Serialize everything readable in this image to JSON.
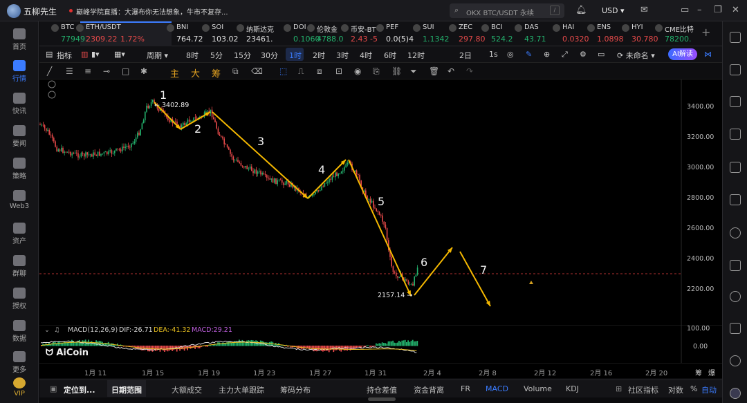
{
  "app": {
    "name": "五柳先生"
  },
  "titlebar": {
    "news": "巅峰学院直播：大瀑布你无法想象，牛市不复存...",
    "search_placeholder": "OKX BTC/USDT 永续",
    "search_shortcut": "/",
    "currency": "USD"
  },
  "sidebar": {
    "items": [
      {
        "label": "首页"
      },
      {
        "label": "行情"
      },
      {
        "label": "快讯"
      },
      {
        "label": "要闻"
      },
      {
        "label": "策略"
      },
      {
        "label": "Web3"
      },
      {
        "label": "资产"
      },
      {
        "label": "群聊"
      },
      {
        "label": "授权"
      },
      {
        "label": "数据"
      },
      {
        "label": "更多"
      },
      {
        "label": "VIP"
      }
    ]
  },
  "tickers": [
    {
      "name": "BTC",
      "price": "77949.",
      "dir": "up"
    },
    {
      "name": "ETH/USDT",
      "price": "2309.22",
      "change": "1.72%",
      "dir": "dn"
    },
    {
      "name": "BNI",
      "price": "764.72",
      "dir": "wh"
    },
    {
      "name": "SOI",
      "price": "103.02",
      "dir": "wh"
    },
    {
      "name": "纳斯达克",
      "price": "23461.",
      "dir": "wh"
    },
    {
      "name": "DOI",
      "price": "0.1060",
      "dir": "up"
    },
    {
      "name": "伦敦金",
      "price": "4788.0",
      "dir": "up"
    },
    {
      "name": "币安-BT",
      "price": "2.43 -5",
      "dir": "dn"
    },
    {
      "name": "PEF",
      "price": "0.0(5)4",
      "dir": "wh"
    },
    {
      "name": "SUI",
      "price": "1.1342",
      "dir": "up"
    },
    {
      "name": "ZEC",
      "price": "297.80",
      "dir": "dn"
    },
    {
      "name": "BCI",
      "price": "524.2",
      "dir": "up"
    },
    {
      "name": "DAS",
      "price": "43.71",
      "dir": "up"
    },
    {
      "name": "HAI",
      "price": "0.0320",
      "dir": "dn"
    },
    {
      "name": "ENS",
      "price": "1.0898",
      "dir": "dn"
    },
    {
      "name": "HYI",
      "price": "30.780",
      "dir": "dn"
    },
    {
      "name": "CME比特",
      "price": "78200.",
      "dir": "up"
    }
  ],
  "toolbar": {
    "indicator": "指标",
    "period": "周期",
    "timeframes": [
      "8时",
      "5分",
      "15分",
      "30分",
      "1时",
      "2时",
      "3时",
      "4时",
      "6时",
      "12时",
      "2日",
      "1s"
    ],
    "active_timeframe": "1时",
    "layout_name": "未命名",
    "ai_label": "AI解读"
  },
  "drawtools": {
    "main": "主",
    "big": "大",
    "chips": "筹"
  },
  "chart": {
    "price_labels": [
      "3400.00",
      "3200.00",
      "3000.00",
      "2800.00",
      "2600.00",
      "2400.00",
      "2200.00"
    ],
    "high_label": "3402.89",
    "low_label": "2157.14",
    "wave_labels": [
      "1",
      "2",
      "3",
      "4",
      "5",
      "6",
      "7"
    ],
    "macd": {
      "params": "MACD(12,26,9)",
      "dif": "DIF:-26.71",
      "dea": "DEA:-41.32",
      "macd": "MACD:29.21"
    },
    "macd_axis": [
      "100.00",
      "0.00"
    ],
    "date_labels": [
      "1月 11",
      "1月 15",
      "1月 19",
      "1月 23",
      "1月 27",
      "1月 31",
      "2月 4",
      "2月 8",
      "2月 12",
      "2月 16",
      "2月 20"
    ],
    "watermark": "AiCoin",
    "corner_labels": [
      "筹",
      "爆"
    ]
  },
  "bottombar": {
    "items": [
      "定位到...",
      "日期范围",
      "大额成交",
      "主力大单跟踪",
      "筹码分布",
      "持仓差值",
      "资金背离",
      "FR",
      "MACD",
      "Volume",
      "KDJ",
      "社区指标",
      "对数",
      "%",
      "自动"
    ]
  },
  "colors": {
    "accent": "#3b7cff",
    "up": "#23b26d",
    "down": "#e84a4a",
    "wave": "#f5b800"
  }
}
